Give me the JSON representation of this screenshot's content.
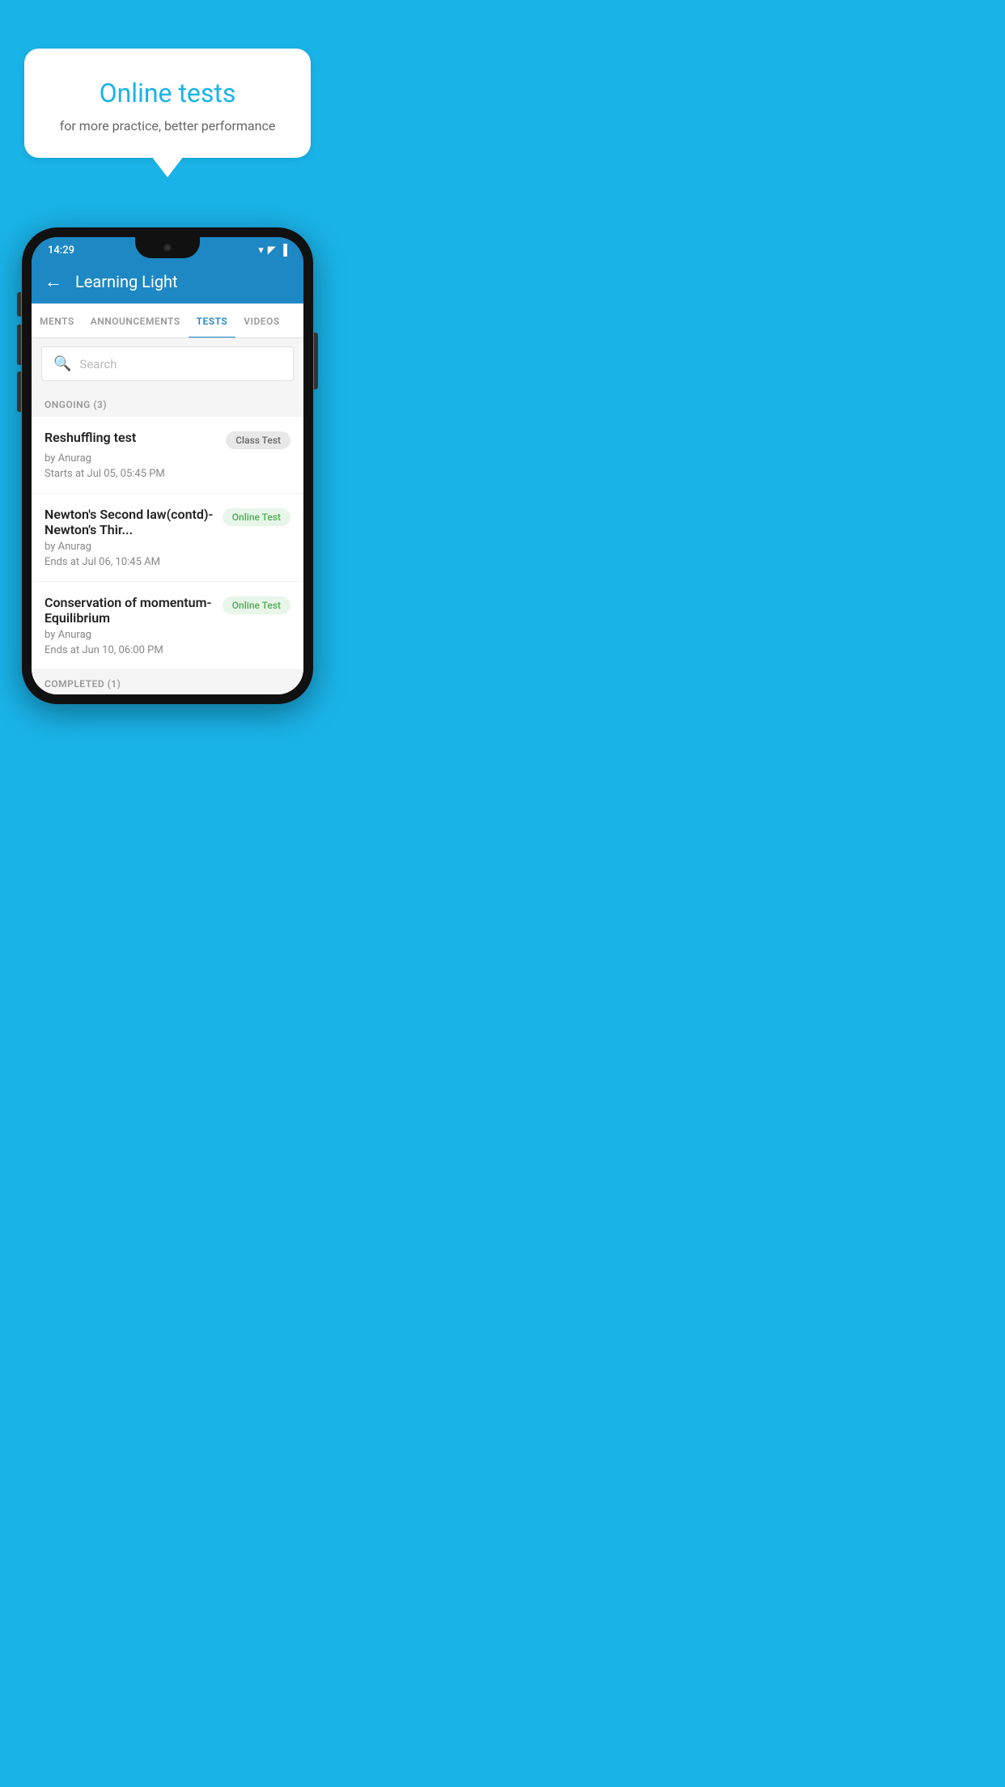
{
  "hero": {
    "bubble_title": "Online tests",
    "bubble_subtitle": "for more practice, better performance"
  },
  "phone": {
    "status_bar": {
      "time": "14:29",
      "icons": [
        "wifi",
        "signal",
        "battery"
      ]
    },
    "app_title": "Learning Light",
    "tabs": [
      {
        "label": "MENTS",
        "active": false
      },
      {
        "label": "ANNOUNCEMENTS",
        "active": false
      },
      {
        "label": "TESTS",
        "active": true
      },
      {
        "label": "VIDEOS",
        "active": false
      }
    ],
    "search_placeholder": "Search",
    "ongoing_label": "ONGOING (3)",
    "tests": [
      {
        "name": "Reshuffling test",
        "badge": "Class Test",
        "badge_type": "class",
        "by": "by Anurag",
        "time_label": "Starts at",
        "time": "Jul 05, 05:45 PM"
      },
      {
        "name": "Newton's Second law(contd)-Newton's Thir...",
        "badge": "Online Test",
        "badge_type": "online",
        "by": "by Anurag",
        "time_label": "Ends at",
        "time": "Jul 06, 10:45 AM"
      },
      {
        "name": "Conservation of momentum-Equilibrium",
        "badge": "Online Test",
        "badge_type": "online",
        "by": "by Anurag",
        "time_label": "Ends at",
        "time": "Jun 10, 06:00 PM"
      }
    ],
    "completed_label": "COMPLETED (1)"
  }
}
